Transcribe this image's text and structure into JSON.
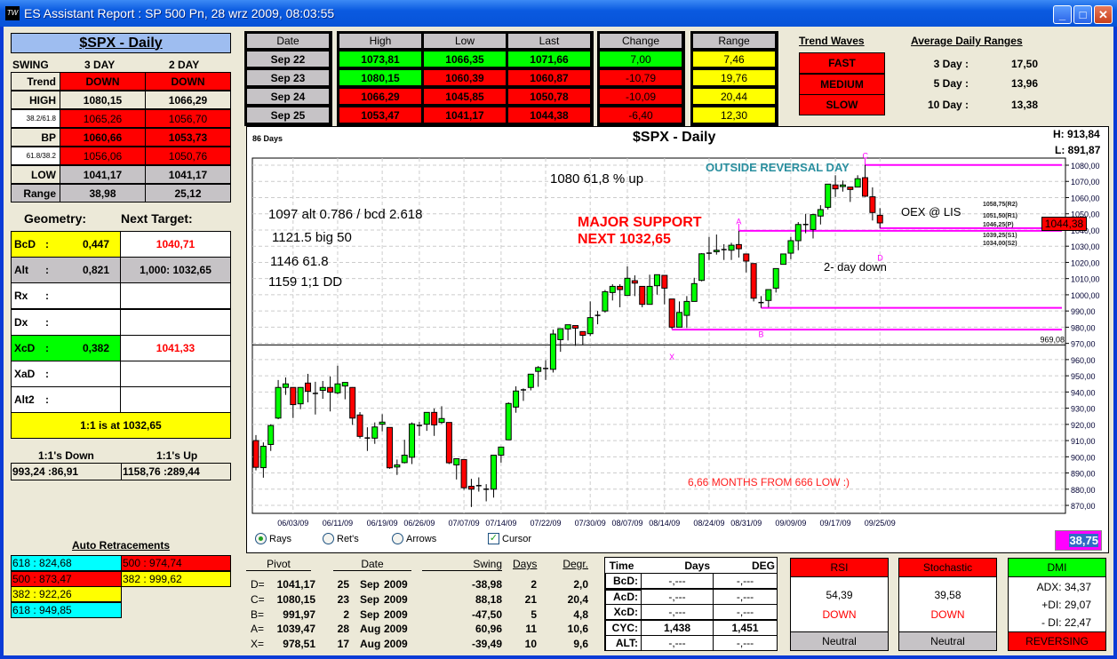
{
  "window": {
    "title": "ES Assistant Report : SP 500  Pn, 28 wrz 2009, 08:03:55",
    "icon": "TW"
  },
  "swing": {
    "title": "$SPX - Daily",
    "header": [
      "SWING",
      "3 DAY",
      "2 DAY"
    ],
    "rows": [
      [
        "Trend",
        "DOWN",
        "DOWN"
      ],
      [
        "HIGH",
        "1080,15",
        "1066,29"
      ],
      [
        "38.2/61.8",
        "1065,26",
        "1056,70"
      ],
      [
        "BP",
        "1060,66",
        "1053,73"
      ],
      [
        "61.8/38.2",
        "1056,06",
        "1050,76"
      ],
      [
        "LOW",
        "1041,17",
        "1041,17"
      ],
      [
        "Range",
        "38,98",
        "25,12"
      ]
    ]
  },
  "geometry": {
    "label": "Geometry:",
    "next_label": "Next Target:",
    "rows": [
      [
        "BcD",
        ":",
        "0,447",
        "1040,71"
      ],
      [
        "Alt",
        ":",
        "0,821",
        "1,000: 1032,65"
      ],
      [
        "Rx",
        ":",
        "",
        ""
      ],
      [
        "Dx",
        ":",
        "",
        ""
      ],
      [
        "XcD",
        ":",
        "0,382",
        "1041,33"
      ],
      [
        "XaD",
        ":",
        "",
        ""
      ],
      [
        "Alt2",
        ":",
        "",
        ""
      ]
    ],
    "one_to_one": "1:1 is at 1032,65",
    "down_label": "1:1's Down",
    "up_label": "1:1's Up",
    "down_value": "993,24 :86,91",
    "up_value": "1158,76 :289,44"
  },
  "auto_retracements": {
    "title": "Auto Retracements",
    "left": [
      "618 : 824,68",
      "500 : 873,47",
      "382 : 922,26",
      "618 : 949,85"
    ],
    "right": [
      "500 : 974,74",
      "382 : 999,62"
    ]
  },
  "daily": {
    "headers": [
      "Date",
      "High",
      "Low",
      "Last",
      "Change",
      "Range"
    ],
    "rows": [
      [
        "Sep  22",
        "1073,81",
        "1066,35",
        "1071,66",
        "7,00",
        "7,46"
      ],
      [
        "Sep  23",
        "1080,15",
        "1060,39",
        "1060,87",
        "-10,79",
        "19,76"
      ],
      [
        "Sep  24",
        "1066,29",
        "1045,85",
        "1050,78",
        "-10,09",
        "20,44"
      ],
      [
        "Sep  25",
        "1053,47",
        "1041,17",
        "1044,38",
        "-6,40",
        "12,30"
      ]
    ]
  },
  "trend_waves": {
    "title": "Trend Waves",
    "items": [
      "FAST",
      "MEDIUM",
      "SLOW"
    ]
  },
  "avg_ranges": {
    "title": "Average Daily Ranges",
    "rows": [
      [
        "3 Day :",
        "17,50"
      ],
      [
        "5 Day :",
        "13,96"
      ],
      [
        "10 Day :",
        "13,38"
      ]
    ]
  },
  "chart": {
    "title": "$SPX - Daily",
    "days": "86 Days",
    "hi": "H:  913,84",
    "lo": "L:  891,87",
    "last": "1044,38",
    "last_value": 1044.38,
    "cursor_value": "38,75",
    "ylim": [
      865,
      1085
    ],
    "yticks": [
      1080,
      1070,
      1060,
      1050,
      1040,
      1030,
      1020,
      1010,
      1000,
      990,
      980,
      970,
      960,
      950,
      940,
      930,
      920,
      910,
      900,
      890,
      880,
      870
    ],
    "ytick_labels": [
      "1080,00",
      "1070,00",
      "1060,00",
      "1050,00",
      "1040,00",
      "1030,00",
      "1020,00",
      "1010,00",
      "1000,00",
      "990,00",
      "980,00",
      "970,00",
      "960,00",
      "950,00",
      "940,00",
      "930,00",
      "920,00",
      "910,00",
      "900,00",
      "890,00",
      "880,00",
      "870,00"
    ],
    "xticks": [
      {
        "i": 6,
        "label": "06/03/09"
      },
      {
        "i": 12,
        "label": "06/11/09"
      },
      {
        "i": 18,
        "label": "06/19/09"
      },
      {
        "i": 23,
        "label": "06/26/09"
      },
      {
        "i": 29,
        "label": "07/07/09"
      },
      {
        "i": 34,
        "label": "07/14/09"
      },
      {
        "i": 40,
        "label": "07/22/09"
      },
      {
        "i": 46,
        "label": "07/30/09"
      },
      {
        "i": 51,
        "label": "08/07/09"
      },
      {
        "i": 56,
        "label": "08/14/09"
      },
      {
        "i": 62,
        "label": "08/24/09"
      },
      {
        "i": 67,
        "label": "08/31/09"
      },
      {
        "i": 73,
        "label": "09/09/09"
      },
      {
        "i": 79,
        "label": "09/17/09"
      },
      {
        "i": 85,
        "label": "09/25/09"
      }
    ],
    "support_line": {
      "value": 969.08,
      "label": "969,08"
    },
    "pivot_lines": [
      {
        "from": 83,
        "value": 1080.15
      },
      {
        "from": 66,
        "value": 1039.47
      },
      {
        "from": 85,
        "value": 1041.17
      },
      {
        "from": 69,
        "value": 991.97
      },
      {
        "from": 57,
        "value": 978.51
      }
    ],
    "pivot_letters": [
      {
        "t": "C",
        "i": 83,
        "v": 1084
      },
      {
        "t": "A",
        "i": 66,
        "v": 1043.5
      },
      {
        "t": "D",
        "i": 85,
        "v": 1021
      },
      {
        "t": "B",
        "i": 69,
        "v": 974
      },
      {
        "t": "X",
        "i": 57,
        "v": 960
      }
    ],
    "floor_pivots": [
      "1058,75(R2)",
      "1051,50(R1)",
      "1046,25(P)",
      "1039,25(S1)",
      "1034,00(S2)"
    ],
    "notes": {
      "n1": "1080 61,8 % up",
      "n2": "1097 alt 0.786 / bcd 2.618",
      "n3": "1121.5 big 50",
      "n4": "1146 61.8",
      "n5": "1159 1;1 DD",
      "major1": "MAJOR SUPPORT",
      "major2": "NEXT 1032,65",
      "outside": "OUTSIDE REVERSAL DAY",
      "oex": "OEX @ LIS",
      "twoday": "2- day down",
      "months": "6,66 MONTHS FROM 666 LOW :)"
    },
    "candles": [
      [
        910.0,
        913.4,
        891.6,
        893.5
      ],
      [
        893.3,
        908.9,
        887.1,
        906.5
      ],
      [
        907.6,
        920.1,
        903.6,
        919.3
      ],
      [
        923.9,
        947.4,
        923.2,
        942.8
      ],
      [
        942.8,
        949.0,
        938.2,
        945.0
      ],
      [
        942.8,
        943.0,
        923.9,
        932.2
      ],
      [
        932.7,
        943.0,
        929.4,
        942.8
      ],
      [
        945.5,
        951.2,
        933.6,
        940.4
      ],
      [
        939.1,
        946.3,
        926.1,
        939.1
      ],
      [
        941.0,
        946.8,
        935.8,
        942.8
      ],
      [
        942.8,
        949.6,
        928.0,
        939.9
      ],
      [
        939.5,
        956.2,
        938.6,
        945.0
      ],
      [
        943.7,
        945.9,
        935.5,
        945.9
      ],
      [
        942.8,
        943.0,
        919.7,
        923.9
      ],
      [
        925.8,
        927.6,
        911.3,
        912.6
      ],
      [
        911.6,
        918.2,
        903.6,
        911.6
      ],
      [
        911.5,
        921.2,
        908.0,
        918.4
      ],
      [
        920.1,
        926.3,
        915.7,
        921.4
      ],
      [
        918.1,
        918.1,
        892.6,
        893.2
      ],
      [
        893.7,
        898.3,
        888.8,
        895.0
      ],
      [
        896.4,
        910.5,
        895.9,
        901.0
      ],
      [
        899.7,
        921.2,
        895.5,
        920.3
      ],
      [
        919.3,
        921.5,
        912.9,
        919.3
      ],
      [
        920.1,
        927.4,
        916.0,
        927.4
      ],
      [
        927.4,
        929.8,
        912.9,
        919.7
      ],
      [
        921.2,
        931.2,
        920.3,
        923.6
      ],
      [
        921.2,
        921.2,
        895.5,
        896.3
      ],
      [
        895.0,
        898.8,
        886.0,
        898.8
      ],
      [
        898.3,
        898.3,
        879.6,
        880.9
      ],
      [
        881.8,
        886.4,
        869.0,
        880.0
      ],
      [
        882.2,
        887.3,
        878.5,
        882.2
      ],
      [
        880.0,
        883.1,
        872.5,
        880.0
      ],
      [
        880.0,
        901.0,
        874.8,
        901.0
      ],
      [
        901.0,
        906.0,
        896.4,
        906.0
      ],
      [
        910.5,
        933.6,
        910.5,
        932.9
      ],
      [
        930.7,
        943.5,
        927.2,
        940.6
      ],
      [
        941.3,
        942.2,
        934.5,
        941.3
      ],
      [
        942.8,
        951.0,
        941.0,
        951.0
      ],
      [
        952.7,
        956.0,
        943.2,
        955.1
      ],
      [
        954.5,
        959.6,
        947.4,
        954.5
      ],
      [
        954.0,
        978.5,
        952.0,
        975.8
      ],
      [
        972.3,
        979.1,
        964.8,
        979.1
      ],
      [
        978.9,
        981.5,
        971.8,
        981.5
      ],
      [
        981.0,
        981.0,
        968.5,
        979.4
      ],
      [
        977.3,
        977.3,
        969.0,
        975.0
      ],
      [
        976.0,
        995.9,
        974.5,
        985.9
      ],
      [
        987.3,
        990.0,
        981.8,
        987.3
      ],
      [
        990.0,
        1003.0,
        989.0,
        1001.9
      ],
      [
        1001.4,
        1006.5,
        996.5,
        1005.2
      ],
      [
        1005.2,
        1006.5,
        992.3,
        1003.2
      ],
      [
        999.6,
        1017.5,
        999.6,
        1010.2
      ],
      [
        1008.7,
        1012.0,
        999.2,
        1007.2
      ],
      [
        1005.2,
        1005.2,
        992.3,
        994.1
      ],
      [
        994.1,
        1012.4,
        994.1,
        1005.2
      ],
      [
        1005.6,
        1012.4,
        1000.1,
        1012.4
      ],
      [
        1012.0,
        1012.0,
        994.1,
        1004.1
      ],
      [
        997.4,
        997.4,
        979.1,
        980.0
      ],
      [
        980.0,
        995.9,
        980.0,
        989.1
      ],
      [
        987.3,
        999.2,
        979.5,
        995.9
      ],
      [
        995.9,
        1010.5,
        995.9,
        1006.9
      ],
      [
        1008.9,
        1025.7,
        1008.3,
        1025.3
      ],
      [
        1025.7,
        1035.8,
        1021.5,
        1025.7
      ],
      [
        1026.6,
        1037.2,
        1024.8,
        1027.5
      ],
      [
        1027.9,
        1031.2,
        1021.5,
        1027.9
      ],
      [
        1027.5,
        1032.1,
        1021.5,
        1030.6
      ],
      [
        1031.0,
        1039.47,
        1023.0,
        1028.4
      ],
      [
        1025.2,
        1025.2,
        1013.8,
        1020.8
      ],
      [
        1019.3,
        1019.3,
        995.9,
        997.9
      ],
      [
        995.2,
        999.2,
        991.97,
        995.2
      ],
      [
        996.5,
        1003.2,
        992.3,
        1003.2
      ],
      [
        1004.1,
        1016.2,
        1001.4,
        1016.2
      ],
      [
        1018.8,
        1025.2,
        1018.8,
        1025.2
      ],
      [
        1025.7,
        1035.8,
        1022.0,
        1033.4
      ],
      [
        1033.4,
        1044.9,
        1027.5,
        1043.4
      ],
      [
        1043.4,
        1050.0,
        1038.0,
        1043.4
      ],
      [
        1040.3,
        1050.0,
        1034.8,
        1049.5
      ],
      [
        1048.6,
        1055.3,
        1043.4,
        1052.6
      ],
      [
        1054.0,
        1068.3,
        1052.6,
        1068.3
      ],
      [
        1067.8,
        1073.8,
        1060.4,
        1065.4
      ],
      [
        1066.8,
        1070.5,
        1063.7,
        1067.8
      ],
      [
        1066.5,
        1066.5,
        1057.3,
        1065.0
      ],
      [
        1066.5,
        1073.81,
        1066.35,
        1071.66
      ],
      [
        1072.3,
        1080.15,
        1060.39,
        1060.87
      ],
      [
        1060.5,
        1066.29,
        1045.85,
        1050.78
      ],
      [
        1049.1,
        1053.47,
        1041.17,
        1044.38
      ]
    ],
    "colors": {
      "up": "#00ff00",
      "down": "#ff0000",
      "pivot": "#ff00ff"
    }
  },
  "options": {
    "rays": "Rays",
    "rets": "Ret's",
    "arrows": "Arrows",
    "cursor": "Cursor"
  },
  "pivots": {
    "headers": [
      "Pivot",
      "Date",
      "Swing",
      "Days",
      "Degr."
    ],
    "rows": [
      [
        "D=",
        "1041,17",
        "25",
        "Sep",
        "2009",
        "-38,98",
        "2",
        "2,0"
      ],
      [
        "C=",
        "1080,15",
        "23",
        "Sep",
        "2009",
        "88,18",
        "21",
        "20,4"
      ],
      [
        "B=",
        "991,97",
        "2",
        "Sep",
        "2009",
        "-47,50",
        "5",
        "4,8"
      ],
      [
        "A=",
        "1039,47",
        "28",
        "Aug",
        "2009",
        "60,96",
        "11",
        "10,6"
      ],
      [
        "X=",
        "978,51",
        "17",
        "Aug",
        "2009",
        "-39,49",
        "10",
        "9,6"
      ]
    ]
  },
  "time_table": {
    "headers": [
      "Time",
      "Days",
      "DEG"
    ],
    "rows": [
      [
        "BcD:",
        "-,---",
        "-,---"
      ],
      [
        "AcD:",
        "-,---",
        "-,---"
      ],
      [
        "XcD:",
        "-,---",
        "-,---"
      ],
      [
        "CYC:",
        "1,438",
        "1,451"
      ],
      [
        "ALT:",
        "-,---",
        "-,---"
      ]
    ]
  },
  "indicators": {
    "rsi": {
      "title": "RSI",
      "value": "54,39",
      "dir": "DOWN",
      "status": "Neutral"
    },
    "stoch": {
      "title": "Stochastic",
      "value": "39,58",
      "dir": "DOWN",
      "status": "Neutral"
    },
    "dmi": {
      "title": "DMI",
      "adx": "ADX:  34,37",
      "pdi": "+DI:  29,07",
      "mdi": "- DI:  22,47",
      "status": "REVERSING"
    }
  }
}
